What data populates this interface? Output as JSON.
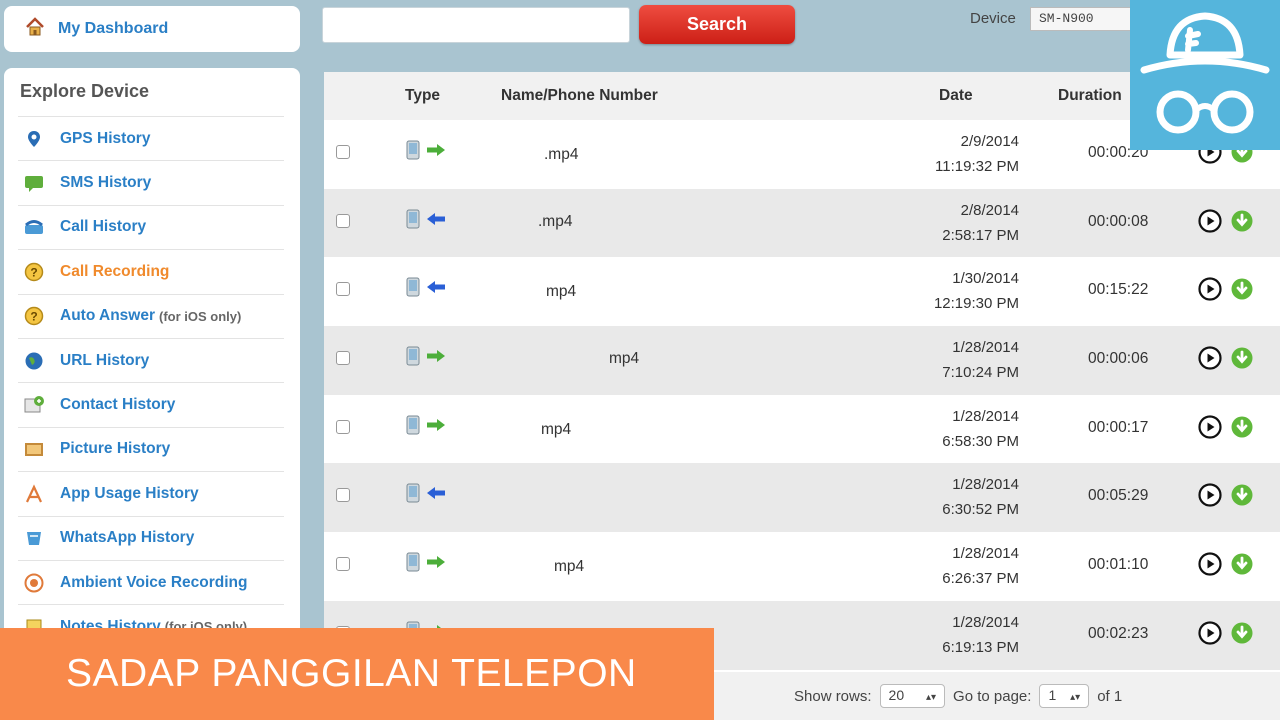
{
  "sidebar": {
    "dashboard_label": "My Dashboard",
    "explore_title": "Explore Device",
    "items": [
      {
        "label": "GPS History",
        "icon": "gps-pin-icon",
        "note": ""
      },
      {
        "label": "SMS History",
        "icon": "sms-bubble-icon",
        "note": ""
      },
      {
        "label": "Call History",
        "icon": "phone-icon",
        "note": ""
      },
      {
        "label": "Call Recording",
        "icon": "question-icon",
        "note": "",
        "active": true
      },
      {
        "label": "Auto Answer",
        "icon": "question-icon",
        "note": "(for iOS only)"
      },
      {
        "label": "URL History",
        "icon": "globe-icon",
        "note": ""
      },
      {
        "label": "Contact History",
        "icon": "contact-card-icon",
        "note": ""
      },
      {
        "label": "Picture History",
        "icon": "picture-icon",
        "note": ""
      },
      {
        "label": "App Usage History",
        "icon": "app-icon",
        "note": ""
      },
      {
        "label": "WhatsApp History",
        "icon": "whatsapp-icon",
        "note": ""
      },
      {
        "label": "Ambient Voice Recording",
        "icon": "record-icon",
        "note": ""
      },
      {
        "label": "Notes History",
        "icon": "notes-icon",
        "note": "(for iOS only)"
      }
    ]
  },
  "search": {
    "placeholder": "",
    "button_label": "Search"
  },
  "device": {
    "label": "Device",
    "value": "SM-N900"
  },
  "table": {
    "headers": {
      "type": "Type",
      "name": "Name/Phone Number",
      "date": "Date",
      "duration": "Duration"
    },
    "rows": [
      {
        "direction": "out",
        "name": ".mp4",
        "date": "2/9/2014",
        "time": "11:19:32 PM",
        "duration": "00:00:20"
      },
      {
        "direction": "in",
        "name": ".mp4",
        "date": "2/8/2014",
        "time": "2:58:17 PM",
        "duration": "00:00:08"
      },
      {
        "direction": "in",
        "name": "mp4",
        "date": "1/30/2014",
        "time": "12:19:30 PM",
        "duration": "00:15:22"
      },
      {
        "direction": "out",
        "name": "mp4",
        "date": "1/28/2014",
        "time": "7:10:24 PM",
        "duration": "00:00:06"
      },
      {
        "direction": "out",
        "name": "mp4",
        "date": "1/28/2014",
        "time": "6:58:30 PM",
        "duration": "00:00:17"
      },
      {
        "direction": "in",
        "name": "",
        "date": "1/28/2014",
        "time": "6:30:52 PM",
        "duration": "00:05:29"
      },
      {
        "direction": "out",
        "name": "mp4",
        "date": "1/28/2014",
        "time": "6:26:37 PM",
        "duration": "00:01:10"
      },
      {
        "direction": "out",
        "name": "",
        "date": "1/28/2014",
        "time": "6:19:13 PM",
        "duration": "00:02:23"
      }
    ]
  },
  "footer": {
    "show_rows_label": "Show rows:",
    "rows_value": "20",
    "goto_label": "Go to page:",
    "page_value": "1",
    "of_label": "of 1"
  },
  "banner": {
    "text": "SADAP PANGGILAN TELEPON"
  },
  "colors": {
    "accent": "#2a7fc6",
    "active": "#f08a2c",
    "search_button": "#d8271d",
    "banner": "#f9894a",
    "logo_bg": "#55b5dc"
  }
}
